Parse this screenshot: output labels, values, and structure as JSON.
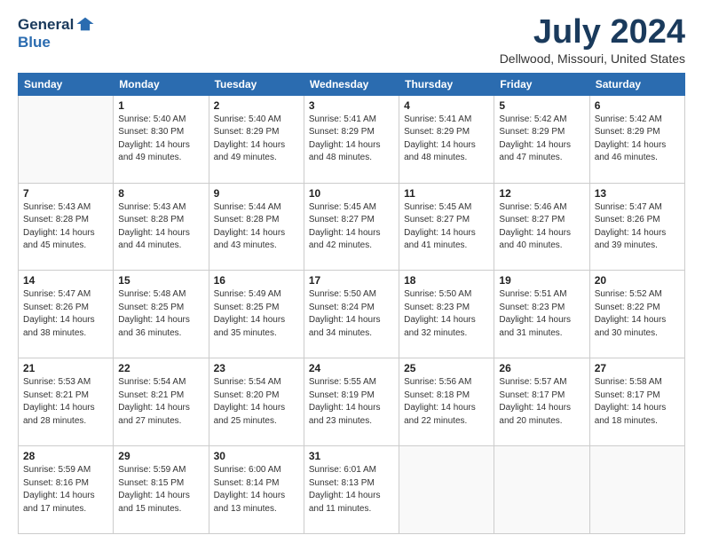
{
  "logo": {
    "general": "General",
    "blue": "Blue"
  },
  "header": {
    "title": "July 2024",
    "subtitle": "Dellwood, Missouri, United States"
  },
  "weekdays": [
    "Sunday",
    "Monday",
    "Tuesday",
    "Wednesday",
    "Thursday",
    "Friday",
    "Saturday"
  ],
  "weeks": [
    [
      {
        "day": "",
        "info": ""
      },
      {
        "day": "1",
        "info": "Sunrise: 5:40 AM\nSunset: 8:30 PM\nDaylight: 14 hours\nand 49 minutes."
      },
      {
        "day": "2",
        "info": "Sunrise: 5:40 AM\nSunset: 8:29 PM\nDaylight: 14 hours\nand 49 minutes."
      },
      {
        "day": "3",
        "info": "Sunrise: 5:41 AM\nSunset: 8:29 PM\nDaylight: 14 hours\nand 48 minutes."
      },
      {
        "day": "4",
        "info": "Sunrise: 5:41 AM\nSunset: 8:29 PM\nDaylight: 14 hours\nand 48 minutes."
      },
      {
        "day": "5",
        "info": "Sunrise: 5:42 AM\nSunset: 8:29 PM\nDaylight: 14 hours\nand 47 minutes."
      },
      {
        "day": "6",
        "info": "Sunrise: 5:42 AM\nSunset: 8:29 PM\nDaylight: 14 hours\nand 46 minutes."
      }
    ],
    [
      {
        "day": "7",
        "info": "Sunrise: 5:43 AM\nSunset: 8:28 PM\nDaylight: 14 hours\nand 45 minutes."
      },
      {
        "day": "8",
        "info": "Sunrise: 5:43 AM\nSunset: 8:28 PM\nDaylight: 14 hours\nand 44 minutes."
      },
      {
        "day": "9",
        "info": "Sunrise: 5:44 AM\nSunset: 8:28 PM\nDaylight: 14 hours\nand 43 minutes."
      },
      {
        "day": "10",
        "info": "Sunrise: 5:45 AM\nSunset: 8:27 PM\nDaylight: 14 hours\nand 42 minutes."
      },
      {
        "day": "11",
        "info": "Sunrise: 5:45 AM\nSunset: 8:27 PM\nDaylight: 14 hours\nand 41 minutes."
      },
      {
        "day": "12",
        "info": "Sunrise: 5:46 AM\nSunset: 8:27 PM\nDaylight: 14 hours\nand 40 minutes."
      },
      {
        "day": "13",
        "info": "Sunrise: 5:47 AM\nSunset: 8:26 PM\nDaylight: 14 hours\nand 39 minutes."
      }
    ],
    [
      {
        "day": "14",
        "info": "Sunrise: 5:47 AM\nSunset: 8:26 PM\nDaylight: 14 hours\nand 38 minutes."
      },
      {
        "day": "15",
        "info": "Sunrise: 5:48 AM\nSunset: 8:25 PM\nDaylight: 14 hours\nand 36 minutes."
      },
      {
        "day": "16",
        "info": "Sunrise: 5:49 AM\nSunset: 8:25 PM\nDaylight: 14 hours\nand 35 minutes."
      },
      {
        "day": "17",
        "info": "Sunrise: 5:50 AM\nSunset: 8:24 PM\nDaylight: 14 hours\nand 34 minutes."
      },
      {
        "day": "18",
        "info": "Sunrise: 5:50 AM\nSunset: 8:23 PM\nDaylight: 14 hours\nand 32 minutes."
      },
      {
        "day": "19",
        "info": "Sunrise: 5:51 AM\nSunset: 8:23 PM\nDaylight: 14 hours\nand 31 minutes."
      },
      {
        "day": "20",
        "info": "Sunrise: 5:52 AM\nSunset: 8:22 PM\nDaylight: 14 hours\nand 30 minutes."
      }
    ],
    [
      {
        "day": "21",
        "info": "Sunrise: 5:53 AM\nSunset: 8:21 PM\nDaylight: 14 hours\nand 28 minutes."
      },
      {
        "day": "22",
        "info": "Sunrise: 5:54 AM\nSunset: 8:21 PM\nDaylight: 14 hours\nand 27 minutes."
      },
      {
        "day": "23",
        "info": "Sunrise: 5:54 AM\nSunset: 8:20 PM\nDaylight: 14 hours\nand 25 minutes."
      },
      {
        "day": "24",
        "info": "Sunrise: 5:55 AM\nSunset: 8:19 PM\nDaylight: 14 hours\nand 23 minutes."
      },
      {
        "day": "25",
        "info": "Sunrise: 5:56 AM\nSunset: 8:18 PM\nDaylight: 14 hours\nand 22 minutes."
      },
      {
        "day": "26",
        "info": "Sunrise: 5:57 AM\nSunset: 8:17 PM\nDaylight: 14 hours\nand 20 minutes."
      },
      {
        "day": "27",
        "info": "Sunrise: 5:58 AM\nSunset: 8:17 PM\nDaylight: 14 hours\nand 18 minutes."
      }
    ],
    [
      {
        "day": "28",
        "info": "Sunrise: 5:59 AM\nSunset: 8:16 PM\nDaylight: 14 hours\nand 17 minutes."
      },
      {
        "day": "29",
        "info": "Sunrise: 5:59 AM\nSunset: 8:15 PM\nDaylight: 14 hours\nand 15 minutes."
      },
      {
        "day": "30",
        "info": "Sunrise: 6:00 AM\nSunset: 8:14 PM\nDaylight: 14 hours\nand 13 minutes."
      },
      {
        "day": "31",
        "info": "Sunrise: 6:01 AM\nSunset: 8:13 PM\nDaylight: 14 hours\nand 11 minutes."
      },
      {
        "day": "",
        "info": ""
      },
      {
        "day": "",
        "info": ""
      },
      {
        "day": "",
        "info": ""
      }
    ]
  ]
}
